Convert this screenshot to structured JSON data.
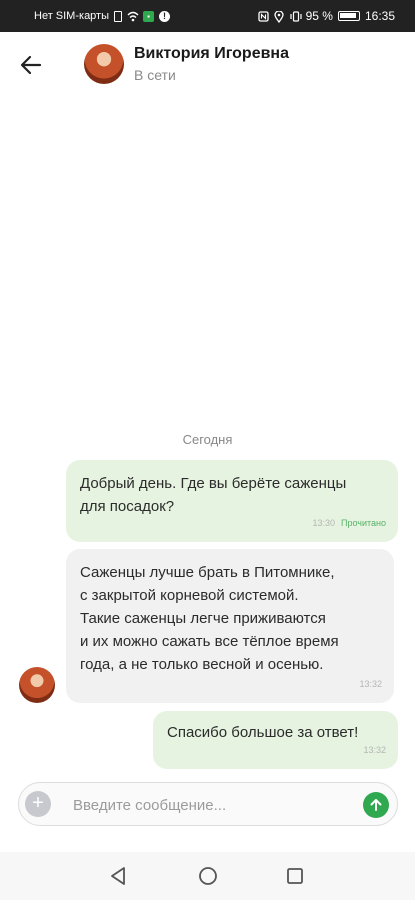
{
  "status_bar": {
    "carrier": "Нет SIM-карты",
    "battery_percent": "95 %",
    "time": "16:35"
  },
  "header": {
    "contact_name": "Виктория Игоревна",
    "contact_status": "В сети"
  },
  "chat": {
    "date_separator": "Сегодня",
    "messages": [
      {
        "direction": "outgoing",
        "text": "Добрый день. Где вы берёте саженцы\nдля посадок?",
        "time": "13:30",
        "status": "Прочитано"
      },
      {
        "direction": "incoming",
        "text": "Саженцы лучше брать в Питомнике,\nс закрытой корневой системой.\nТакие саженцы легче приживаются\nи их можно сажать все тёплое время\nгода, а не только весной и осенью.",
        "time": "13:32"
      },
      {
        "direction": "outgoing",
        "text": "Спасибо большое за ответ!",
        "time": "13:32"
      }
    ]
  },
  "composer": {
    "placeholder": "Введите сообщение..."
  },
  "colors": {
    "accent": "#2fa84f",
    "outgoing_bubble": "#e6f3e0",
    "incoming_bubble": "#f1f1f2"
  }
}
